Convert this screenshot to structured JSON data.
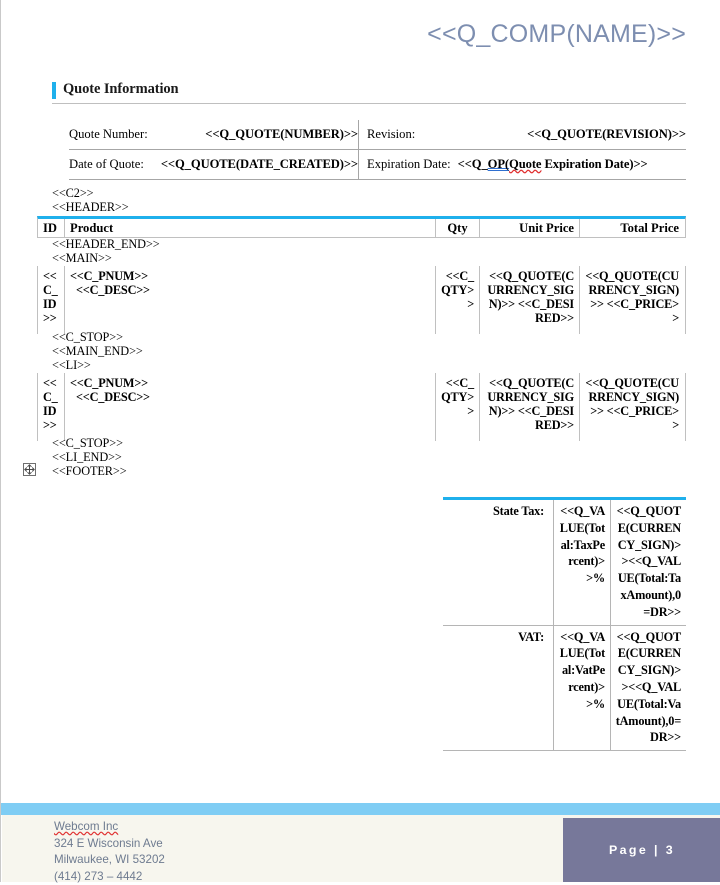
{
  "document": {
    "title": "<<Q_COMP(NAME)>>"
  },
  "section": {
    "heading": "Quote Information"
  },
  "quote_info": {
    "rows": [
      {
        "left_label": "Quote Number:",
        "left_value": "<<Q_QUOTE(NUMBER)>>",
        "right_label": "Revision:",
        "right_value": "<<Q_QUOTE(REVISION)>>"
      },
      {
        "left_label": "Date of Quote:",
        "left_value": "<<Q_QUOTE(DATE_CREATED)>>",
        "right_label": "Expiration Date:",
        "right_value_prefix": "<<Q_",
        "right_value_grammar": "OP(",
        "right_value_spell": "Quote",
        "right_value_suffix": " Expiration Date)>>"
      }
    ]
  },
  "tags": {
    "c2": "<<C2>>",
    "header": "<<HEADER>>",
    "header_end": "<<HEADER_END>>",
    "main": "<<MAIN>>",
    "c_stop_1": "<<C_STOP>>",
    "main_end": "<<MAIN_END>>",
    "li": "<<LI>>",
    "c_stop_2": "<<C_STOP>>",
    "li_end": "<<LI_END>>",
    "footer": "<<FOOTER>>"
  },
  "product_table": {
    "columns": [
      "ID",
      "Product",
      "Qty",
      "Unit Price",
      "Total Price"
    ],
    "rows": [
      {
        "id": "<<C_ID>>",
        "product_line1": "<<C_PNUM>>",
        "product_line2": "<<C_DESC>>",
        "qty": "<<C_QTY>>",
        "unit_price": "<<Q_QUOTE(CURRENCY_SIGN)>> <<C_DESIRED>>",
        "total_price": "<<Q_QUOTE(CURRENCY_SIGN)>> <<C_PRICE>>"
      },
      {
        "id": "<<C_ID>>",
        "product_line1": "<<C_PNUM>>",
        "product_line2": "<<C_DESC>>",
        "qty": "<<C_QTY>>",
        "unit_price": "<<Q_QUOTE(CURRENCY_SIGN)>> <<C_DESIRED>>",
        "total_price": "<<Q_QUOTE(CURRENCY_SIGN)>> <<C_PRICE>>"
      }
    ]
  },
  "totals_table": {
    "rows": [
      {
        "label": "State Tax:",
        "percent": "<<Q_VALUE(Total:TaxPercent)>>%",
        "amount": "<<Q_QUOTE(CURRENCY_SIGN)>><<Q_VALUE(Total:TaxAmount),0=DR>>"
      },
      {
        "label": "VAT:",
        "percent": "<<Q_VALUE(Total:VatPercent)>>%",
        "amount": "<<Q_QUOTE(CURRENCY_SIGN)>><<Q_VALUE(Total:VatAmount),0=DR>>"
      }
    ]
  },
  "footer": {
    "company": "Webcom Inc",
    "address_line1": "324 E Wisconsin Ave",
    "address_line2": "Milwaukee, WI 53202",
    "phone": "(414) 273 – 4442",
    "page_label": "Page | 3"
  },
  "icons": {
    "table_move_handle": "table-move-handle-icon",
    "section_accent": "section-accent-bar"
  },
  "colors": {
    "accent_cyan": "#1fb0ec",
    "footer_band": "#7fcdf4",
    "footer_bg": "#f7f6ee",
    "page_badge": "#77789a",
    "title_blue": "#7d8eb0"
  }
}
